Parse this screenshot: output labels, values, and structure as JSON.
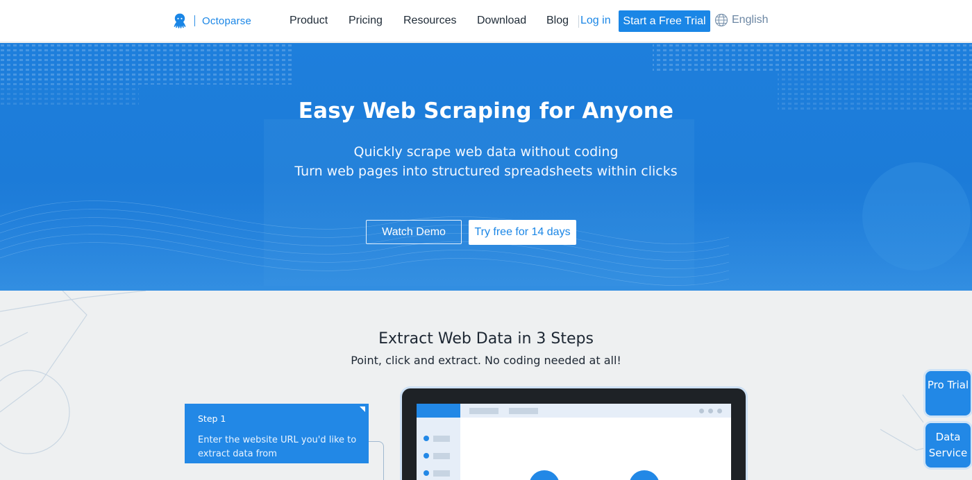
{
  "header": {
    "brand": "Octoparse",
    "nav": [
      "Product",
      "Pricing",
      "Resources",
      "Download",
      "Blog"
    ],
    "login": "Log in",
    "cta": "Start a Free Trial",
    "language": "English"
  },
  "hero": {
    "title": "Easy Web Scraping for Anyone",
    "subtitle_line1": "Quickly scrape web data without coding",
    "subtitle_line2": "Turn web pages into structured spreadsheets within clicks",
    "demo_button": "Watch Demo",
    "try_button": "Try free for 14 days"
  },
  "steps": {
    "title": "Extract Web Data in 3 Steps",
    "lead": "Point, click and extract. No coding needed at all!",
    "step1_title": "Step 1",
    "step1_desc": "Enter the website URL you'd like to extract data from"
  },
  "side": {
    "pro_trial": "Pro Trial",
    "data_service": "Data Service"
  },
  "colors": {
    "brand": "#1a86e6",
    "hero_bg": "#1e7fdc",
    "section_bg": "#eef0f1"
  },
  "icons": [
    "octopus-logo-icon",
    "globe-icon",
    "corner-fold-icon"
  ]
}
